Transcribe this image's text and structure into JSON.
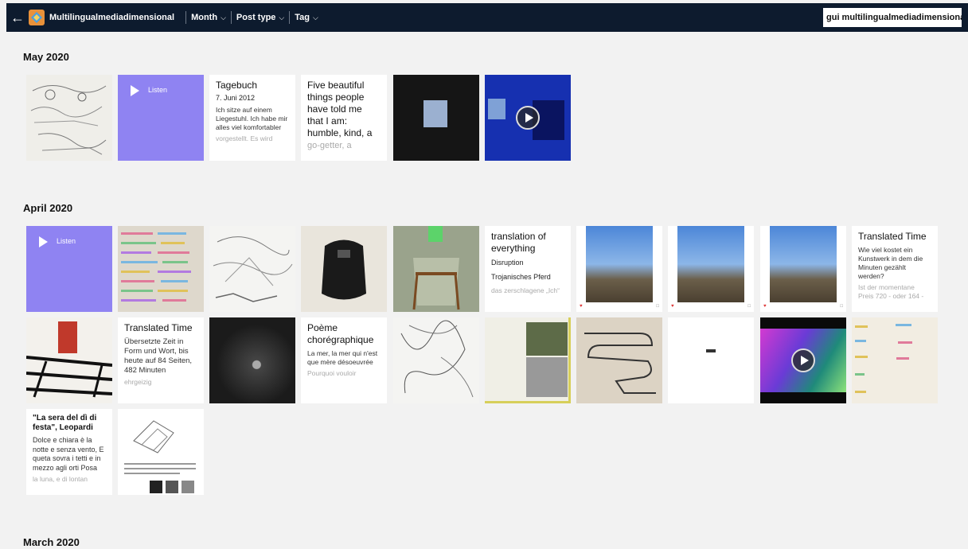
{
  "topbar": {
    "blog_name": "Multilingualmediadimensional",
    "menu": [
      {
        "label": "Month"
      },
      {
        "label": "Post type"
      },
      {
        "label": "Tag"
      }
    ],
    "search_value": "gui multilingualmediadimensional"
  },
  "sections": [
    {
      "label": "May 2020"
    },
    {
      "label": "April 2020"
    },
    {
      "label": "March 2020"
    }
  ],
  "may": {
    "audio_label": "Listen",
    "tagebuch": {
      "title": "Tagebuch",
      "date": "7. Juni 2012",
      "body": "Ich sitze auf einem Liegestuhl. Ich habe mir alles viel komfortabler",
      "fade": "vorgestellt. Es wird"
    },
    "five": {
      "title": "Five beautiful things people have told me that I am:",
      "body": "humble, kind, a",
      "fade": "go-getter, a"
    }
  },
  "april": {
    "audio_label": "Listen",
    "translation": {
      "title": "translation of everything",
      "line1": "Disruption",
      "line2": "Trojanisches Pferd",
      "fade": "das zerschlagene „Ich“"
    },
    "translated_time_1": {
      "title": "Translated Time",
      "body": "Wie viel kostet ein Kunstwerk in dem die Minuten gezählt werden?",
      "fade": "Ist der momentane Preis 720 - oder 164 -"
    },
    "translated_time_2": {
      "title": "Translated Time",
      "body": "Übersetzte Zeit in Form und Wort, bis heute auf 84 Seiten, 482 Minuten",
      "fade": "ehrgeizig"
    },
    "poeme": {
      "title": "Poème chorégraphique",
      "body": "La mer, la mer qui n'est que mère désoeuvrée",
      "fade": "Pourquoi vouloir"
    },
    "sera": {
      "title": "\"La sera del dì di festa\", Leopardi",
      "body": "Dolce e chiara è la notte e senza vento, E queta sovra i tetti e in mezzo agli orti Posa",
      "fade": "la luna, e di lontan"
    }
  },
  "colors": {
    "topbar": "#0d1b2e",
    "audio": "#8f83f2",
    "background": "#f2f2f2"
  }
}
